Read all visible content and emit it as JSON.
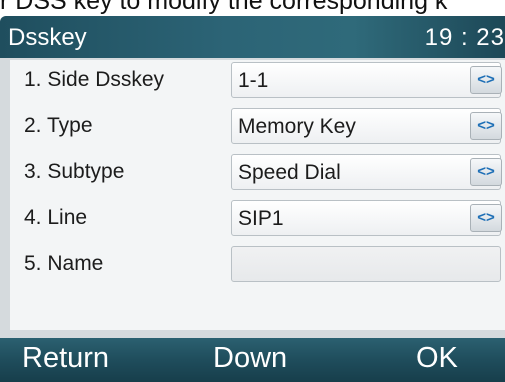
{
  "caption": "r DSS key to modify the corresponding k",
  "header": {
    "title": "Dsskey",
    "time": "19 : 23"
  },
  "rows": [
    {
      "label": "1.  Side Dsskey",
      "value": "1-1",
      "switch": "<>"
    },
    {
      "label": "2.  Type",
      "value": "Memory Key",
      "switch": "<>"
    },
    {
      "label": "3.  Subtype",
      "value": "Speed Dial",
      "switch": "<>"
    },
    {
      "label": "4.  Line",
      "value": "SIP1",
      "switch": "<>"
    },
    {
      "label": "5.  Name",
      "value": ""
    }
  ],
  "softkeys": {
    "return": "Return",
    "down": "Down",
    "ok": "OK"
  },
  "colors": {
    "accent": "#1e6fb6",
    "titlebar": "#2c6476",
    "panel": "#f3f5f6"
  }
}
